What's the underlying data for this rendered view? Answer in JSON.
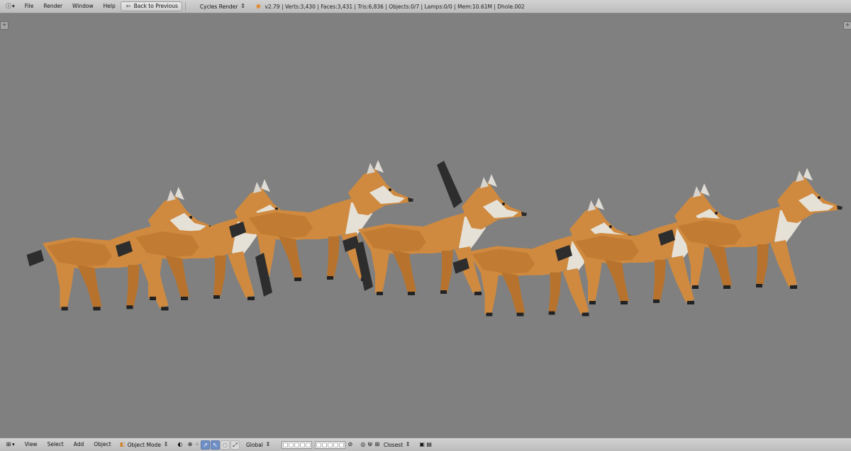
{
  "top": {
    "editor_icon": "info-icon",
    "menu": [
      "File",
      "Render",
      "Window",
      "Help"
    ],
    "back_button": "Back to Previous",
    "render_engine": "Cycles Render",
    "stats": "v2.79 | Verts:3,430 | Faces:3,431 | Tris:6,836 | Objects:0/7 | Lamps:0/0 | Mem:10.61M | Dhole.002"
  },
  "bottom": {
    "view_menus": [
      "View",
      "Select",
      "Add",
      "Object"
    ],
    "mode": "Object Mode",
    "transform_orientation": "Global",
    "snap_target": "Closest"
  },
  "colors": {
    "fur": "#cf8a3f",
    "fur_dark": "#b7732d",
    "white": "#e6e1d7",
    "tail": "#2d2d2d",
    "background": "#808080"
  }
}
